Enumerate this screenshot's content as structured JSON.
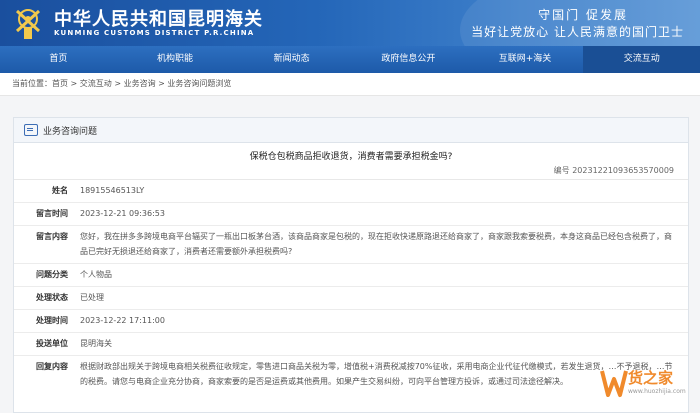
{
  "header": {
    "title": "中华人民共和国昆明海关",
    "subtitle": "KUNMING CUSTOMS DISTRICT P.R.CHINA",
    "slogan_line1": "守国门    促发展",
    "slogan_line2": "当好让党放心    让人民满意的国门卫士"
  },
  "nav": {
    "items": [
      "首页",
      "机构职能",
      "新闻动态",
      "政府信息公开",
      "互联网+海关",
      "交流互动"
    ],
    "active": "交流互动"
  },
  "breadcrumb": {
    "label": "当前位置：",
    "path": "首页 > 交流互动 > 业务咨询 > 业务咨询问题浏览"
  },
  "panel": {
    "title": "业务咨询问题",
    "question_title": "保税仓包税商品拒收退货，消费者需要承担税金吗?",
    "number_label": "编号",
    "number": "20231221093653570009",
    "fields": [
      {
        "label": "姓名",
        "value": "18915546513LY"
      },
      {
        "label": "留言时间",
        "value": "2023-12-21 09:36:53"
      },
      {
        "label": "留言内容",
        "value": "您好，我在拼多多跨境电商平台辐买了一瓶出口板茅台酒，该商品商家是包税的，现在拒收快递原路退还给商家了，商家跟我索要税费，本身这商品已经包含税费了，商品已完好无损退还给商家了，消费者还需要额外承担税费吗?"
      },
      {
        "label": "问题分类",
        "value": "个人物品"
      },
      {
        "label": "处理状态",
        "value": "已处理"
      },
      {
        "label": "处理时间",
        "value": "2023-12-22 17:11:00"
      },
      {
        "label": "投送单位",
        "value": "昆明海关"
      },
      {
        "label": "回复内容",
        "value": "根据财政部出规关于跨境电商相关税费征收规定，零售进口商品关税为零，增值税+消费税减按70%征收，采用电商企业代征代缴模式，若发生退货，…不予退税，…节的税费。请您与电商企业充分协商，商家索要的是否是运费或其他费用。如果产生交易纠纷，可向平台管理方投诉，或通过司法途径解决。"
      }
    ]
  },
  "watermark": {
    "text": "货之家",
    "url": "www.huozhijia.com"
  },
  "colors": {
    "brand_blue": "#1d5aa9",
    "watermark_orange": "#f08a2c"
  }
}
